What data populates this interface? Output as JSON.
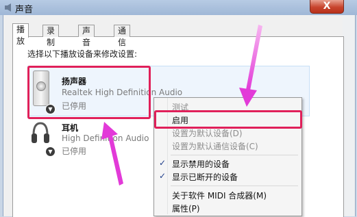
{
  "window": {
    "title": "声音",
    "close_label": "X"
  },
  "tabs": [
    {
      "label": "播放",
      "active": true
    },
    {
      "label": "录制",
      "active": false
    },
    {
      "label": "声音",
      "active": false
    },
    {
      "label": "通信",
      "active": false
    }
  ],
  "instruction": "选择以下播放设备来修改设置:",
  "devices": [
    {
      "name": "扬声器",
      "driver": "Realtek High Definition Audio",
      "status": "已停用"
    },
    {
      "name": "耳机",
      "driver": "High Definition Audio",
      "status": "已停用"
    }
  ],
  "context_menu": {
    "items": [
      {
        "label": "测试",
        "disabled": true
      },
      {
        "label": "启用",
        "disabled": false
      },
      {
        "label": "设置为默认设备(D)",
        "disabled": true
      },
      {
        "label": "设置为默认通信设备(C)",
        "disabled": true
      },
      {
        "label": "显示禁用的设备",
        "checked": true
      },
      {
        "label": "显示已断开的设备",
        "checked": true
      },
      {
        "label": "关于软件 MIDI 合成器(M)",
        "disabled": false
      },
      {
        "label": "属性(P)",
        "disabled": false
      }
    ],
    "check_glyph": "✓"
  },
  "annotation": {
    "highlight_color": "#e0205a",
    "arrow_color": "#e23ad8"
  }
}
